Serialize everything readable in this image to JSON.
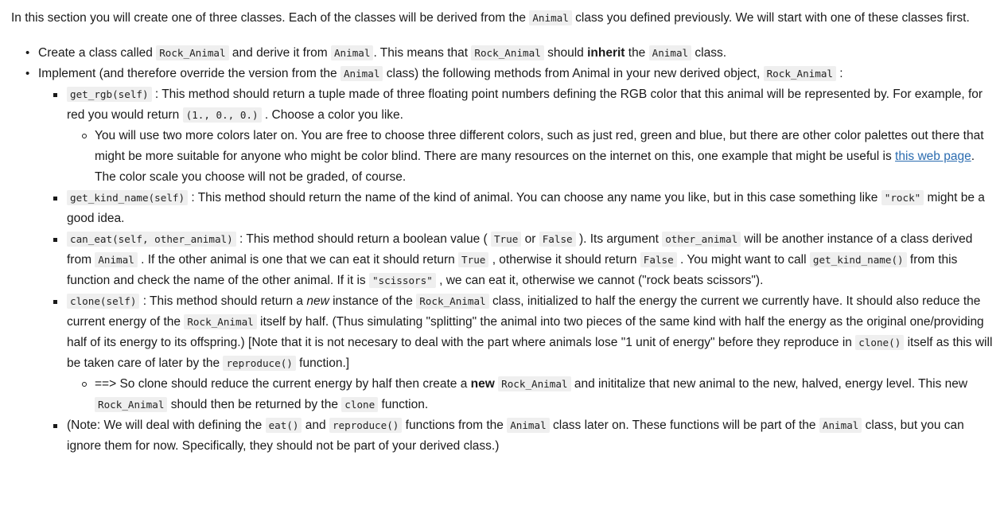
{
  "document": {
    "intro": {
      "part1": "In this section you will create one of three classes. Each of the classes will be derived from the ",
      "code1": "Animal",
      "part2": " class you defined previously. We will start with one of these classes first."
    },
    "bullets": {
      "create_class": {
        "p1": "Create a class called ",
        "c1": "Rock_Animal",
        "p2": " and derive it from ",
        "c2": "Animal",
        "p3": ". This means that ",
        "c3": "Rock_Animal",
        "p4": " should ",
        "bold1": "inherit",
        "p5": " the ",
        "c4": "Animal",
        "p6": " class."
      },
      "implement": {
        "p1": "Implement (and therefore override the version from the ",
        "c1": "Animal",
        "p2": " class) the following methods from Animal in your new derived object, ",
        "c2": "Rock_Animal",
        "p3": " :"
      },
      "get_rgb": {
        "c1": "get_rgb(self)",
        "p1": " : This method should return a tuple made of three floating point numbers defining the RGB color that this animal will be represented by. For example, for red you would return ",
        "c2": "(1., 0., 0.)",
        "p2": " . Choose a color you like.",
        "sub": {
          "p1": "You will use two more colors later on. You are free to choose three different colors, such as just red, green and blue, but there are other color palettes out there that might be more suitable for anyone who might be color blind. There are many resources on the internet on this, one example that might be useful is ",
          "link": "this web page",
          "p2": ". The color scale you choose will not be graded, of course."
        }
      },
      "get_kind_name": {
        "c1": "get_kind_name(self)",
        "p1": " : This method should return the name of the kind of animal. You can choose any name you like, but in this case something like ",
        "c2": "\"rock\"",
        "p2": " might be a good idea."
      },
      "can_eat": {
        "c1": "can_eat(self, other_animal)",
        "p1": " : This method should return a boolean value ( ",
        "c2": "True",
        "p2": " or ",
        "c3": "False",
        "p3": " ). Its argument ",
        "c4": "other_animal",
        "p4": " will be another instance of a class derived from ",
        "c5": "Animal",
        "p5": " . If the other animal is one that we can eat it should return ",
        "c6": "True",
        "p6": " , otherwise it should return ",
        "c7": "False",
        "p7": " . You might want to call ",
        "c8": "get_kind_name()",
        "p8": " from this function and check the name of the other animal. If it is ",
        "c9": "\"scissors\"",
        "p9": " , we can eat it, otherwise we cannot (\"rock beats scissors\")."
      },
      "clone": {
        "c1": "clone(self)",
        "p1": " : This method should return a ",
        "italic1": "new",
        "p2": " instance of the ",
        "c2": "Rock_Animal",
        "p3": " class, initialized to half the energy the current we currently have. It should also reduce the current energy of the ",
        "c3": "Rock_Animal",
        "p4": " itself by half. (Thus simulating \"splitting\" the animal into two pieces of the same kind with half the energy as the original one/providing half of its energy to its offspring.) [Note that it is not necesary to deal with the part where animals lose \"1 unit of energy\" before they reproduce in ",
        "c4": "clone()",
        "p5": " itself as this will be taken care of later by the ",
        "c5": "reproduce()",
        "p6": " function.]",
        "sub": {
          "p1": "==> So clone should reduce the current energy by half then create a ",
          "bold1": "new",
          "c1": "Rock_Animal",
          "p2": " and inititalize that new animal to the new, halved, energy level. This new ",
          "c2": "Rock_Animal",
          "p3": " should then be returned by the ",
          "c3": "clone",
          "p4": " function."
        }
      },
      "note": {
        "p1": "(Note: We will deal with defining the ",
        "c1": "eat()",
        "p2": " and ",
        "c2": "reproduce()",
        "p3": " functions from the ",
        "c3": "Animal",
        "p4": " class later on. These functions will be part of the ",
        "c4": "Animal",
        "p5": " class, but you can ignore them for now. Specifically, they should not be part of your derived class.)"
      }
    }
  },
  "colors": {
    "text": "#1a1a1a",
    "code_background": "#efefef",
    "link": "#2b6cb0",
    "page_background": "#ffffff"
  }
}
